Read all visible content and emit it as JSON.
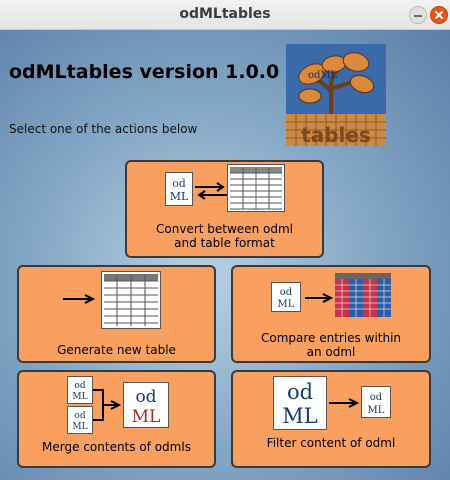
{
  "window": {
    "title": "odMLtables"
  },
  "header": {
    "version_title": "odMLtables version 1.0.0",
    "instruction": "Select one of the actions below"
  },
  "logo": {
    "top_text": "odML",
    "bottom_text": "tables"
  },
  "icons": {
    "odml_text_top": "od",
    "odml_text_bottom": "ML"
  },
  "actions": [
    {
      "label_line1": "Convert between odml",
      "label_line2": "and table format"
    },
    {
      "label_line1": "Generate new table"
    },
    {
      "label_line1": "Compare entries within",
      "label_line2": "an odml"
    },
    {
      "label_line1": "Merge contents of odmls"
    },
    {
      "label_line1": "Filter content of odml"
    }
  ],
  "colors": {
    "button_fill": "#f9a060",
    "background": "#88aac8",
    "logo_bg": "#2e4f86",
    "logo_leaf": "#d98a3c",
    "table_red": "#c8334a",
    "table_blue": "#2b5ea8"
  }
}
